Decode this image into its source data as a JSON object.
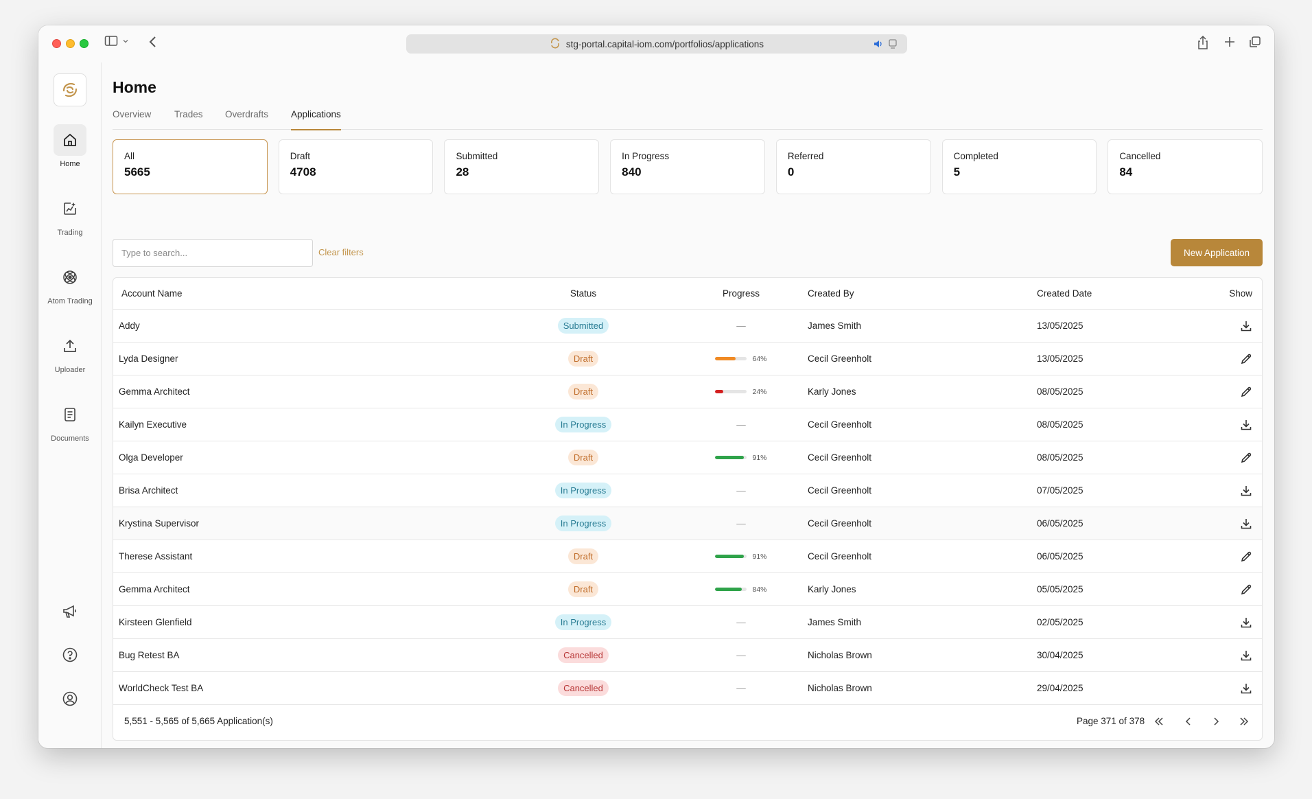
{
  "browser": {
    "url": "stg-portal.capital-iom.com/portfolios/applications"
  },
  "sidebar": {
    "items": [
      {
        "label": "Home",
        "icon": "home-icon"
      },
      {
        "label": "Trading",
        "icon": "trading-icon"
      },
      {
        "label": "Atom Trading",
        "icon": "atom-icon"
      },
      {
        "label": "Uploader",
        "icon": "upload-icon"
      },
      {
        "label": "Documents",
        "icon": "document-icon"
      }
    ]
  },
  "header": {
    "title": "Home",
    "tabs": [
      "Overview",
      "Trades",
      "Overdrafts",
      "Applications"
    ]
  },
  "summary_cards": [
    {
      "label": "All",
      "value": "5665"
    },
    {
      "label": "Draft",
      "value": "4708"
    },
    {
      "label": "Submitted",
      "value": "28"
    },
    {
      "label": "In Progress",
      "value": "840"
    },
    {
      "label": "Referred",
      "value": "0"
    },
    {
      "label": "Completed",
      "value": "5"
    },
    {
      "label": "Cancelled",
      "value": "84"
    }
  ],
  "toolbar": {
    "search_placeholder": "Type to search...",
    "clear_filters": "Clear filters",
    "new_application": "New Application"
  },
  "table": {
    "columns": [
      "Account Name",
      "Status",
      "Progress",
      "Created By",
      "Created Date",
      "Show"
    ],
    "rows": [
      {
        "name": "Addy",
        "status": "Submitted",
        "progress": "—",
        "created_by": "James Smith",
        "date": "13/05/2025",
        "action": "download"
      },
      {
        "name": "Lyda Designer",
        "status": "Draft",
        "progress": "64%",
        "progress_value": 0.64,
        "created_by": "Cecil Greenholt",
        "date": "13/05/2025",
        "action": "edit"
      },
      {
        "name": "Gemma Architect",
        "status": "Draft",
        "progress": "24%",
        "progress_value": 0.24,
        "created_by": "Karly Jones",
        "date": "08/05/2025",
        "action": "edit"
      },
      {
        "name": "Kailyn Executive",
        "status": "In Progress",
        "progress": "—",
        "created_by": "Cecil Greenholt",
        "date": "08/05/2025",
        "action": "download"
      },
      {
        "name": "Olga Developer",
        "status": "Draft",
        "progress": "91%",
        "progress_value": 0.91,
        "created_by": "Cecil Greenholt",
        "date": "08/05/2025",
        "action": "edit"
      },
      {
        "name": "Brisa Architect",
        "status": "In Progress",
        "progress": "—",
        "created_by": "Cecil Greenholt",
        "date": "07/05/2025",
        "action": "download"
      },
      {
        "name": "Krystina Supervisor",
        "status": "In Progress",
        "progress": "—",
        "created_by": "Cecil Greenholt",
        "date": "06/05/2025",
        "action": "download"
      },
      {
        "name": "Therese Assistant",
        "status": "Draft",
        "progress": "91%",
        "progress_value": 0.91,
        "created_by": "Cecil Greenholt",
        "date": "06/05/2025",
        "action": "edit"
      },
      {
        "name": "Gemma Architect",
        "status": "Draft",
        "progress": "84%",
        "progress_value": 0.84,
        "created_by": "Karly Jones",
        "date": "05/05/2025",
        "action": "edit"
      },
      {
        "name": "Kirsteen Glenfield",
        "status": "In Progress",
        "progress": "—",
        "created_by": "James Smith",
        "date": "02/05/2025",
        "action": "download"
      },
      {
        "name": "Bug Retest BA",
        "status": "Cancelled",
        "progress": "—",
        "created_by": "Nicholas Brown",
        "date": "30/04/2025",
        "action": "download"
      },
      {
        "name": "WorldCheck Test BA",
        "status": "Cancelled",
        "progress": "—",
        "created_by": "Nicholas Brown",
        "date": "29/04/2025",
        "action": "download"
      }
    ]
  },
  "pagination": {
    "count_text": "5,551 - 5,565 of 5,665 Application(s)",
    "page_text": "Page 371 of 378"
  },
  "colors": {
    "accent": "#b8873a",
    "progress_orange": "#f08a24",
    "progress_red": "#d42020",
    "progress_green": "#2fa34a"
  }
}
